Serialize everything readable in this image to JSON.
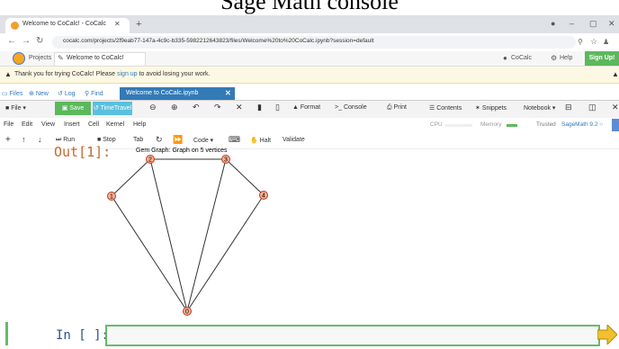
{
  "caption": "Sage Math console",
  "browser": {
    "tab_title": "Welcome to CoCalc! - CoCalc",
    "url": "cocalc.com/projects/2f9eab77-147a-4c9c-b335-5982212643823/files/Welcome%20to%20CoCalc.ipynb?session=default"
  },
  "cocalc_nav": {
    "projects": "Projects",
    "tab": "Welcome to CoCalc!",
    "cocalc": "CoCalc",
    "help": "Help",
    "signup": "Sign Up!"
  },
  "banner": {
    "text_before": "Thank you for trying CoCalc! Please ",
    "link": "sign up",
    "text_after": " to avoid losing your work."
  },
  "files_bar": {
    "files": "Files",
    "new": "New",
    "log": "Log",
    "find": "Find",
    "file_tab": "Welcome to CoCalc.ipynb"
  },
  "toolbar": {
    "file": "File",
    "save": "Save",
    "timetravel": "TimeTravel",
    "format": "Format",
    "console": "Console",
    "print": "Print",
    "contents": "Contents",
    "snippets": "Snippets",
    "notebook": "Notebook"
  },
  "menu": [
    "File",
    "Edit",
    "View",
    "Insert",
    "Cell",
    "Kernel",
    "Help"
  ],
  "status": {
    "cpu": "CPU",
    "memory": "Memory",
    "trusted": "Trusted",
    "kernel": "SageMath 9.2"
  },
  "cell_toolbar": {
    "run": "Run",
    "stop": "Stop",
    "tab": "Tab",
    "code": "Code",
    "halt": "Halt",
    "validate": "Validate"
  },
  "output": {
    "prompt": "Out[1]:",
    "graph_title": "Gem Graph: Graph on 5 vertices",
    "vertices": [
      "0",
      "1",
      "2",
      "3",
      "4"
    ]
  },
  "input": {
    "prompt": "In [ ]:"
  },
  "colors": {
    "node_fill": "#f4b090",
    "node_stroke": "#c0392b",
    "green": "#5cb85c",
    "blue": "#337ab7",
    "run_arrow": "#f0c030"
  }
}
